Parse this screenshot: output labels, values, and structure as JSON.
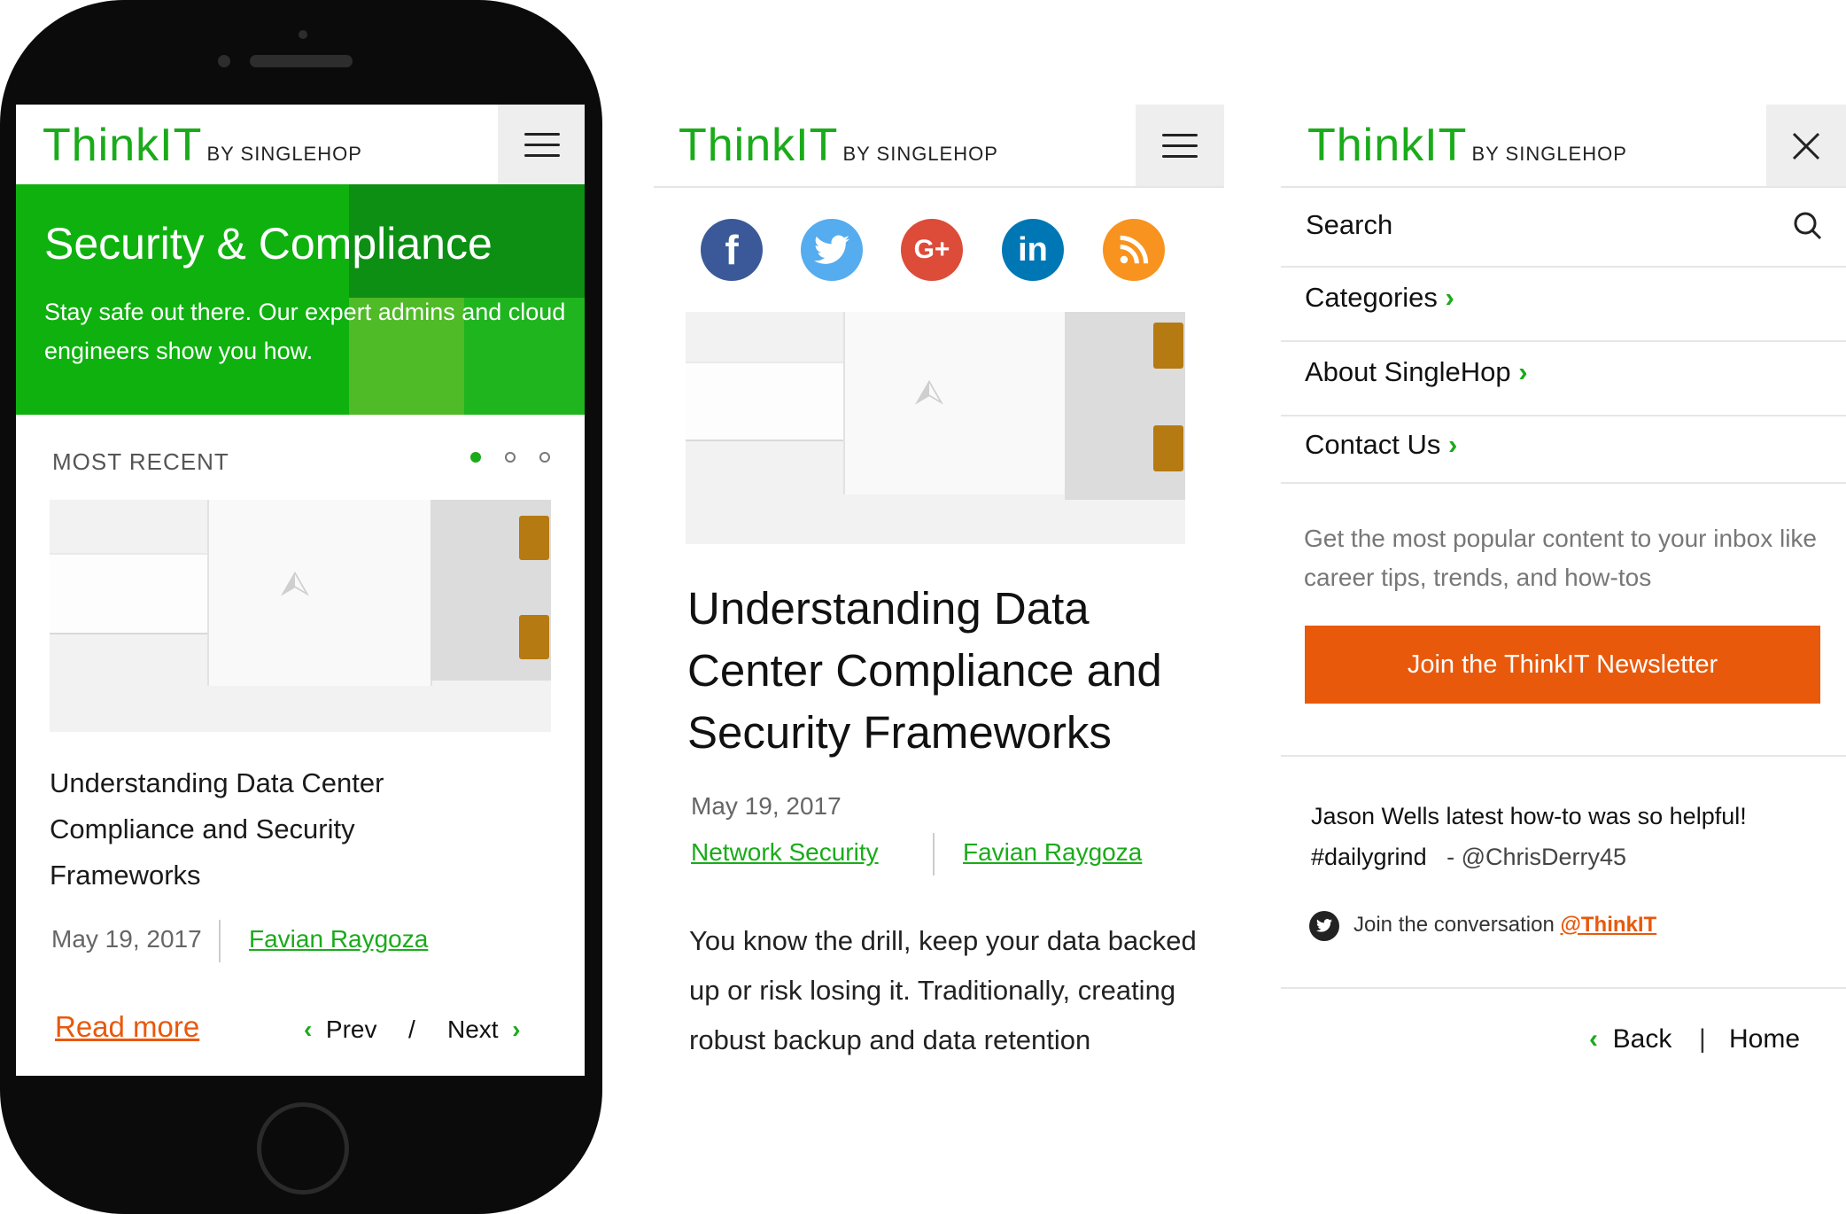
{
  "brand": {
    "name": "ThinkIT",
    "byline": "BY SINGLEHOP",
    "color": "#1aab1a",
    "accent": "#e8590c"
  },
  "phone": {
    "hero": {
      "title": "Security & Compliance",
      "subtitle": "Stay safe out there. Our expert admins and cloud engineers show you how."
    },
    "section_label": "MOST RECENT",
    "carousel_dots": {
      "count": 3,
      "active_index": 0
    },
    "card": {
      "title": "Understanding Data Center Compliance and Security Frameworks",
      "date": "May 19, 2017",
      "author": "Favian Raygoza"
    },
    "read_more": "Read more",
    "prev": "Prev",
    "separator": "/",
    "next": "Next"
  },
  "article": {
    "social_icons": [
      {
        "name": "facebook-icon",
        "glyph": "f",
        "color": "#3b5998"
      },
      {
        "name": "twitter-icon",
        "glyph": "t",
        "color": "#55acee"
      },
      {
        "name": "google-plus-icon",
        "glyph": "G+",
        "color": "#dd4b39"
      },
      {
        "name": "linkedin-icon",
        "glyph": "in",
        "color": "#0077b5"
      },
      {
        "name": "rss-icon",
        "glyph": "rss",
        "color": "#f7931e"
      }
    ],
    "title": "Understanding Data Center Compliance and Security Frameworks",
    "date": "May 19, 2017",
    "category": "Network Security",
    "author": "Favian Raygoza",
    "body": "You know the drill, keep your data backed up or risk losing it. Traditionally, creating robust backup and data retention"
  },
  "menu": {
    "search_label": "Search",
    "items": [
      {
        "label": "Categories"
      },
      {
        "label": "About SingleHop"
      },
      {
        "label": "Contact Us"
      }
    ],
    "promo_text": "Get the most popular content to your inbox like career tips, trends, and how-tos",
    "newsletter_button": "Join the ThinkIT Newsletter",
    "quote": "Jason Wells latest how-to was so helpful! #dailygrind",
    "quote_author": "- @ChrisDerry45",
    "join_text": "Join the conversation",
    "twitter_handle": "@ThinkIT",
    "back": "Back",
    "separator": "|",
    "home": "Home"
  }
}
